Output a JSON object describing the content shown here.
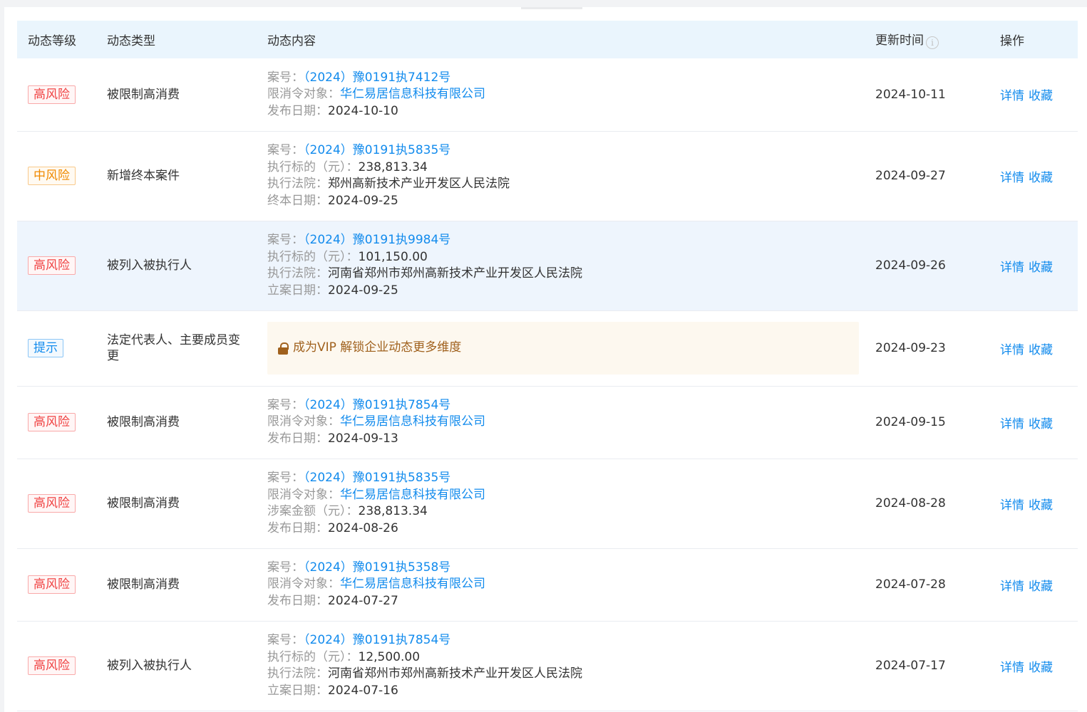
{
  "header": {
    "level": "动态等级",
    "type": "动态类型",
    "content": "动态内容",
    "time": "更新时间",
    "op": "操作"
  },
  "icons": {
    "time_info": "info-icon",
    "lock": "lock-icon"
  },
  "colors": {
    "high_risk": "#f04343",
    "mid_risk": "#f08a00",
    "tip": "#128bed",
    "link": "#128bed",
    "header_bg": "#eaf5fd",
    "vip_text": "#a0611d"
  },
  "actions": {
    "detail": "详情",
    "collect": "收藏"
  },
  "vip": {
    "text": "成为VIP 解锁企业动态更多维度"
  },
  "rows": [
    {
      "level": "高风险",
      "type": "被限制高消费",
      "fields": [
        {
          "label": "案号：",
          "value": "（2024）豫0191执7412号"
        },
        {
          "label": "限消令对象：",
          "value": "华仁易居信息科技有限公司"
        },
        {
          "label": "发布日期：",
          "value": "2024-10-10"
        }
      ],
      "time": "2024-10-11"
    },
    {
      "level": "中风险",
      "type": "新增终本案件",
      "fields": [
        {
          "label": "案号：",
          "value": "（2024）豫0191执5835号"
        },
        {
          "label": "执行标的（元）：",
          "value": "238,813.34"
        },
        {
          "label": "执行法院：",
          "value": "郑州高新技术产业开发区人民法院"
        },
        {
          "label": "终本日期：",
          "value": "2024-09-25"
        }
      ],
      "time": "2024-09-27"
    },
    {
      "level": "高风险",
      "type": "被列入被执行人",
      "fields": [
        {
          "label": "案号：",
          "value": "（2024）豫0191执9984号"
        },
        {
          "label": "执行标的（元）：",
          "value": "101,150.00"
        },
        {
          "label": "执行法院：",
          "value": "河南省郑州市郑州高新技术产业开发区人民法院"
        },
        {
          "label": "立案日期：",
          "value": "2024-09-25"
        }
      ],
      "time": "2024-09-26"
    },
    {
      "level": "提示",
      "type": "法定代表人、主要成员变更",
      "time": "2024-09-23"
    },
    {
      "level": "高风险",
      "type": "被限制高消费",
      "fields": [
        {
          "label": "案号：",
          "value": "（2024）豫0191执7854号"
        },
        {
          "label": "限消令对象：",
          "value": "华仁易居信息科技有限公司"
        },
        {
          "label": "发布日期：",
          "value": "2024-09-13"
        }
      ],
      "time": "2024-09-15"
    },
    {
      "level": "高风险",
      "type": "被限制高消费",
      "fields": [
        {
          "label": "案号：",
          "value": "（2024）豫0191执5835号"
        },
        {
          "label": "限消令对象：",
          "value": "华仁易居信息科技有限公司"
        },
        {
          "label": "涉案金额（元）：",
          "value": "238,813.34"
        },
        {
          "label": "发布日期：",
          "value": "2024-08-26"
        }
      ],
      "time": "2024-08-28"
    },
    {
      "level": "高风险",
      "type": "被限制高消费",
      "fields": [
        {
          "label": "案号：",
          "value": "（2024）豫0191执5358号"
        },
        {
          "label": "限消令对象：",
          "value": "华仁易居信息科技有限公司"
        },
        {
          "label": "发布日期：",
          "value": "2024-07-27"
        }
      ],
      "time": "2024-07-28"
    },
    {
      "level": "高风险",
      "type": "被列入被执行人",
      "fields": [
        {
          "label": "案号：",
          "value": "（2024）豫0191执7854号"
        },
        {
          "label": "执行标的（元）：",
          "value": "12,500.00"
        },
        {
          "label": "执行法院：",
          "value": "河南省郑州市郑州高新技术产业开发区人民法院"
        },
        {
          "label": "立案日期：",
          "value": "2024-07-16"
        }
      ],
      "time": "2024-07-17"
    }
  ]
}
